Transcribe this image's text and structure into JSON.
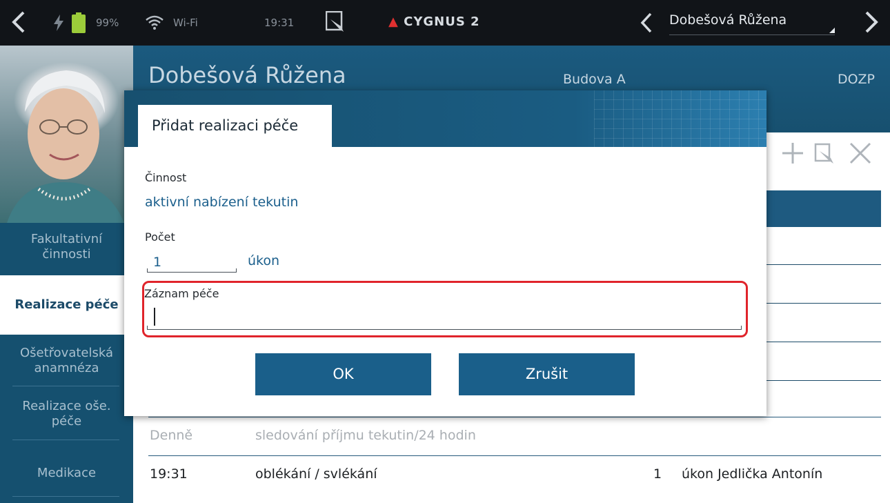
{
  "status_bar": {
    "battery_percent": "99%",
    "wifi_label": "Wi-Fi",
    "time": "19:31",
    "brand": "CYGNUS 2"
  },
  "patient_selector": {
    "value": "Dobešová Růžena"
  },
  "header": {
    "patient_name": "Dobešová Růžena",
    "building": "Budova A",
    "unit": "DOZP"
  },
  "sidebar": {
    "items": [
      {
        "label": "Fakultativní\nčinnosti"
      },
      {
        "label": "Realizace péče"
      },
      {
        "label": "Ošetřovatelská\nanamnéza"
      },
      {
        "label": "Realizace oše.\npéče"
      },
      {
        "label": "Medikace"
      }
    ]
  },
  "list": {
    "rows": [
      {
        "time": "Denně",
        "activity": "sledování příjmu tekutin/24 hodin",
        "count": "",
        "unit_person": ""
      },
      {
        "time": "19:31",
        "activity": "oblékání / svlékání",
        "count": "1",
        "unit_person": "úkon Jedlička Antonín"
      }
    ]
  },
  "dialog": {
    "title": "Přidat realizaci péče",
    "activity_label": "Činnost",
    "activity_value": "aktivní nabízení tekutin",
    "count_label": "Počet",
    "count_value": "1",
    "count_unit": "úkon",
    "note_label": "Záznam péče",
    "note_value": "",
    "ok_label": "OK",
    "cancel_label": "Zrušit"
  },
  "colors": {
    "topbar": "#111418",
    "header": "#1b5a7f",
    "sidebar": "#15506f",
    "button": "#1a5f8a",
    "highlight": "#e0242b",
    "accent_text": "#1b5f8c"
  }
}
